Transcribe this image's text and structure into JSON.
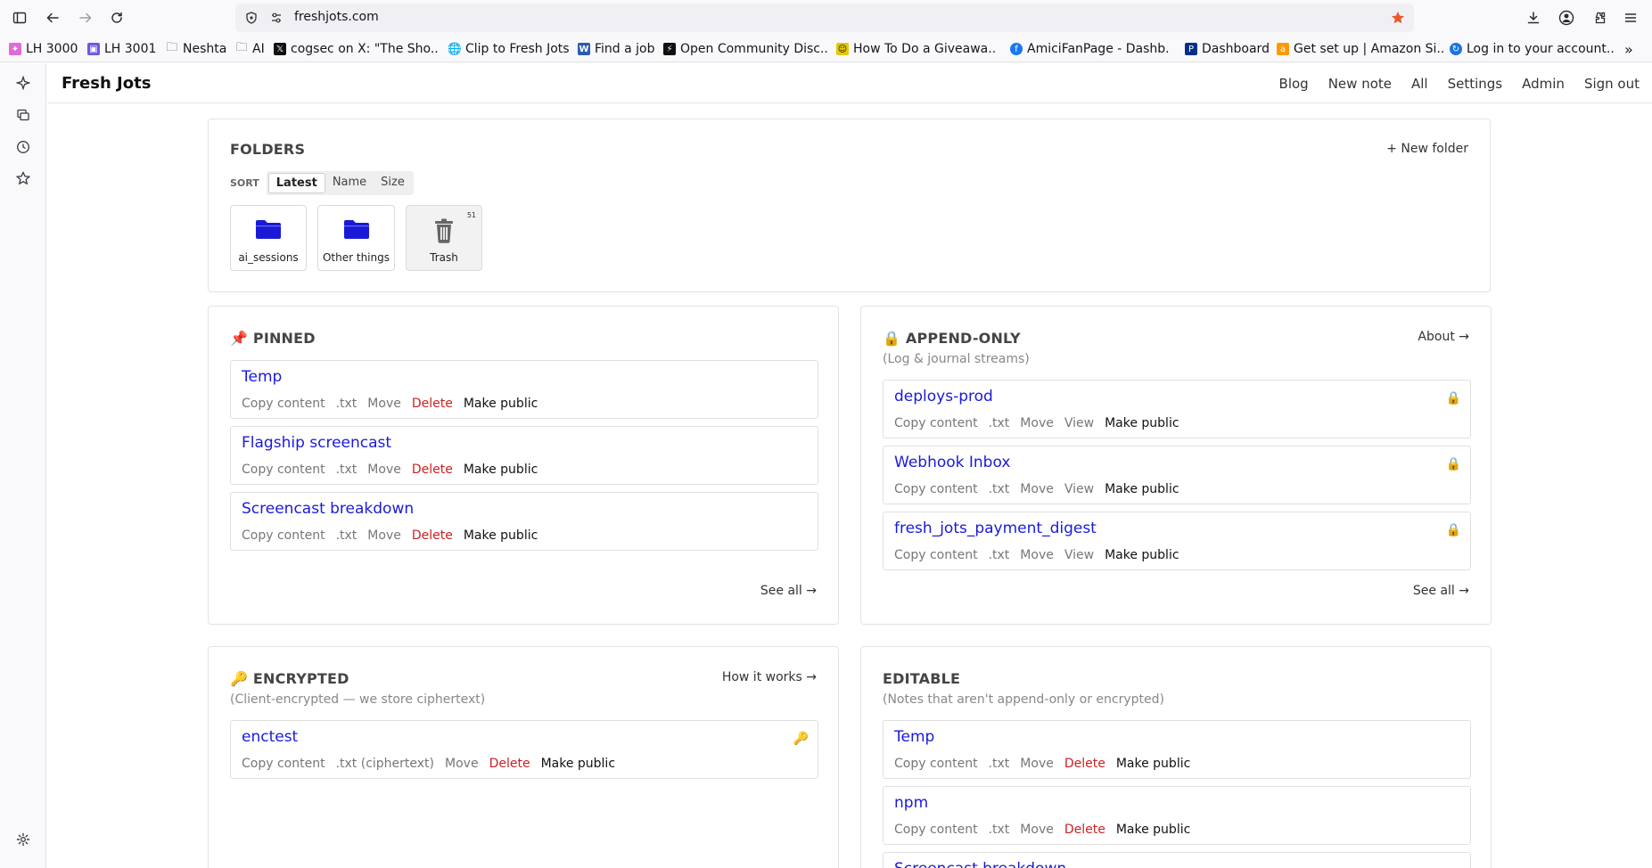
{
  "browser": {
    "url": "freshjots.com",
    "bookmarks": [
      {
        "label": "LH 3000",
        "icon": "pinwheel-icon",
        "color": "#e06ad8"
      },
      {
        "label": "LH 3001",
        "icon": "app-icon",
        "color": "#6a5ae0"
      },
      {
        "label": "Neshta",
        "icon": "folder-icon",
        "color": "#555555"
      },
      {
        "label": "AI",
        "icon": "folder-icon",
        "color": "#555555"
      },
      {
        "label": "cogsec on X: \"The Sho...",
        "icon": "x-icon",
        "color": "#111111"
      },
      {
        "label": "Clip to Fresh Jots",
        "icon": "globe-icon",
        "color": "#555555"
      },
      {
        "label": "Find a job",
        "icon": "w-icon",
        "color": "#2a5db0"
      },
      {
        "label": "Open Community Disc...",
        "icon": "community-icon",
        "color": "#111111"
      },
      {
        "label": "How To Do a Giveawa...",
        "icon": "smile-icon",
        "color": "#e5c900"
      },
      {
        "label": "AmiciFanPage - Dashb...",
        "icon": "facebook-icon",
        "color": "#1877f2"
      },
      {
        "label": "Dashboard",
        "icon": "paypal-icon",
        "color": "#003087"
      },
      {
        "label": "Get set up | Amazon Si...",
        "icon": "amazon-icon",
        "color": "#ff9900"
      },
      {
        "label": "Log in to your account...",
        "icon": "login-icon",
        "color": "#1a73e8"
      }
    ]
  },
  "app": {
    "brand": "Fresh Jots",
    "nav": [
      "Blog",
      "New note",
      "All",
      "Settings",
      "Admin",
      "Sign out"
    ]
  },
  "folders": {
    "title": "FOLDERS",
    "new_folder": "+ New folder",
    "sort_label": "SORT",
    "sort_options": [
      "Latest",
      "Name",
      "Size"
    ],
    "items": [
      {
        "name": "ai_sessions"
      },
      {
        "name": "Other things"
      },
      {
        "name": "Trash",
        "badge": "51"
      }
    ]
  },
  "pinned": {
    "title": "📌 PINNED",
    "see_all": "See all →",
    "notes": [
      {
        "title": "Temp",
        "actions": [
          "Copy content",
          ".txt",
          "Move",
          "Delete",
          "Make public"
        ]
      },
      {
        "title": "Flagship screencast",
        "actions": [
          "Copy content",
          ".txt",
          "Move",
          "Delete",
          "Make public"
        ]
      },
      {
        "title": "Screencast breakdown",
        "actions": [
          "Copy content",
          ".txt",
          "Move",
          "Delete",
          "Make public"
        ]
      }
    ]
  },
  "append_only": {
    "title": "🔒 APPEND-ONLY",
    "subtitle": "(Log & journal streams)",
    "about": "About →",
    "see_all": "See all →",
    "notes": [
      {
        "title": "deploys-prod",
        "actions": [
          "Copy content",
          ".txt",
          "Move",
          "View",
          "Make public"
        ]
      },
      {
        "title": "Webhook Inbox",
        "actions": [
          "Copy content",
          ".txt",
          "Move",
          "View",
          "Make public"
        ]
      },
      {
        "title": "fresh_jots_payment_digest",
        "actions": [
          "Copy content",
          ".txt",
          "Move",
          "View",
          "Make public"
        ]
      }
    ]
  },
  "encrypted": {
    "title": "🔑 ENCRYPTED",
    "subtitle": "(Client-encrypted — we store ciphertext)",
    "how": "How it works →",
    "notes": [
      {
        "title": "enctest",
        "actions": [
          "Copy content",
          ".txt (ciphertext)",
          "Move",
          "Delete",
          "Make public"
        ]
      }
    ]
  },
  "editable": {
    "title": "EDITABLE",
    "subtitle": "(Notes that aren't append-only or encrypted)",
    "notes": [
      {
        "title": "Temp",
        "actions": [
          "Copy content",
          ".txt",
          "Move",
          "Delete",
          "Make public"
        ]
      },
      {
        "title": "npm",
        "actions": [
          "Copy content",
          ".txt",
          "Move",
          "Delete",
          "Make public"
        ]
      },
      {
        "title": "Screencast breakdown",
        "actions": []
      }
    ]
  },
  "colors": {
    "link": "#1a1adb",
    "danger": "#cc2222",
    "folder": "#1a1ad6"
  }
}
